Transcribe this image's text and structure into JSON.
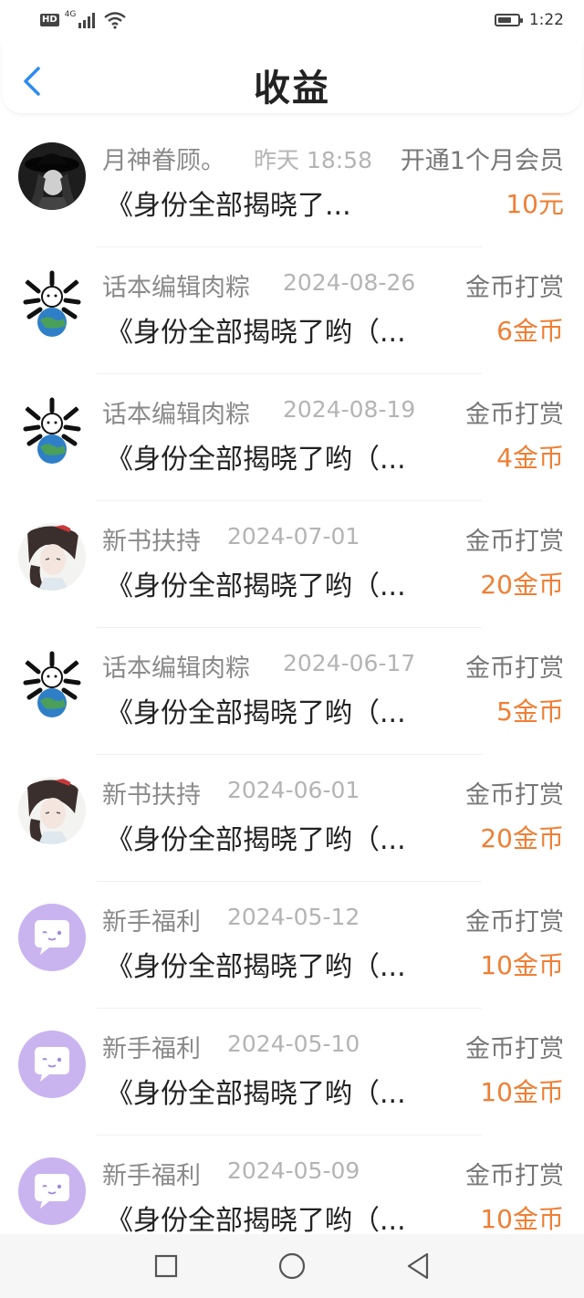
{
  "status_bar": {
    "network": "4G",
    "hd_badge": "HD",
    "time": "1:22",
    "battery_level": 0.7,
    "icons": [
      "hd-icon",
      "signal-icon",
      "wifi-icon",
      "battery-icon"
    ]
  },
  "header": {
    "title": "收益",
    "back_icon": "chevron-left-icon",
    "accent": "#2d8cf0"
  },
  "colors": {
    "amount": "#ef7f34",
    "name": "#8a8a8a",
    "date": "#b4b4b4",
    "type": "#777777"
  },
  "entries": [
    {
      "name": "月神眷顾。",
      "date": "昨天 18:58",
      "type": "开通1个月会员",
      "title": "《身份全部揭晓了...",
      "amount": "10元",
      "avatar": "dark-hat-avatar"
    },
    {
      "name": "话本编辑肉粽",
      "date": "2024-08-26",
      "type": "金币打赏",
      "title": "《身份全部揭晓了哟（...",
      "amount": "6金币",
      "avatar": "bone-cat-avatar"
    },
    {
      "name": "话本编辑肉粽",
      "date": "2024-08-19",
      "type": "金币打赏",
      "title": "《身份全部揭晓了哟（...",
      "amount": "4金币",
      "avatar": "bone-cat-avatar"
    },
    {
      "name": "新书扶持",
      "date": "2024-07-01",
      "type": "金币打赏",
      "title": "《身份全部揭晓了哟（...",
      "amount": "20金币",
      "avatar": "anime-character-avatar"
    },
    {
      "name": "话本编辑肉粽",
      "date": "2024-06-17",
      "type": "金币打赏",
      "title": "《身份全部揭晓了哟（...",
      "amount": "5金币",
      "avatar": "bone-cat-avatar"
    },
    {
      "name": "新书扶持",
      "date": "2024-06-01",
      "type": "金币打赏",
      "title": "《身份全部揭晓了哟（...",
      "amount": "20金币",
      "avatar": "anime-character-avatar"
    },
    {
      "name": "新手福利",
      "date": "2024-05-12",
      "type": "金币打赏",
      "title": "《身份全部揭晓了哟（...",
      "amount": "10金币",
      "avatar": "chat-bubble-avatar"
    },
    {
      "name": "新手福利",
      "date": "2024-05-10",
      "type": "金币打赏",
      "title": "《身份全部揭晓了哟（...",
      "amount": "10金币",
      "avatar": "chat-bubble-avatar"
    },
    {
      "name": "新手福利",
      "date": "2024-05-09",
      "type": "金币打赏",
      "title": "《身份全部揭晓了哟（...",
      "amount": "10金币",
      "avatar": "chat-bubble-avatar"
    }
  ],
  "nav_bar": {
    "buttons": [
      "recents-square-icon",
      "home-circle-icon",
      "back-triangle-icon"
    ]
  }
}
